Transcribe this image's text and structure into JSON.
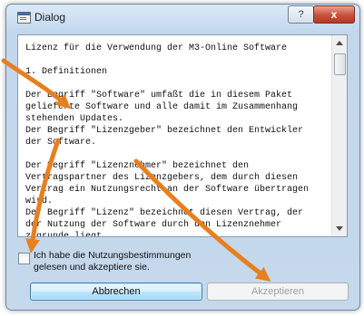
{
  "dialog": {
    "title": "Dialog",
    "help_label": "?",
    "close_label": "x",
    "license_text": "Lizenz für die Verwendung der M3-Online Software\n\n1. Definitionen\n\nDer Begriff \"Software\" umfaßt die in diesem Paket\ngelieferte Software und alle damit im Zusammenhang\nstehenden Updates.\nDer Begriff \"Lizenzgeber\" bezeichnet den Entwickler\nder Software.\n\nDer Begriff \"Lizenznehmer\" bezeichnet den\nVertragspartner des Lizenzgebers, dem durch diesen\nVertrag ein Nutzungsrecht an der Software übertragen\nwird.\nDer Begriff \"Lizenz\" bezeichnet diesen Vertrag, der\nder Nutzung der Software durch den Lizenznehmer\nzugrunde liegt.",
    "checkbox_label": "Ich habe die Nutzungsbestimmungen\ngelesen und akzeptiere sie.",
    "checkbox_checked": false,
    "cancel_label": "Abbrechen",
    "accept_label": "Akzeptieren",
    "accept_enabled": false
  },
  "colors": {
    "arrow": "#e87f1e",
    "close_button": "#c7503c",
    "focus_border": "#3c7fb1"
  },
  "icons": [
    "dialog-app-icon",
    "scroll-up-arrow-icon",
    "scroll-down-arrow-icon"
  ]
}
